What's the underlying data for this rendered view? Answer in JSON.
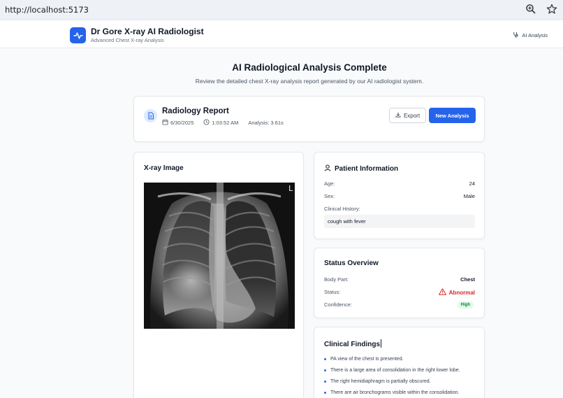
{
  "browser": {
    "url": "http://localhost:5173",
    "icons": [
      "zoom-icon",
      "bookmark-star-icon"
    ]
  },
  "header": {
    "title": "Dr Gore X-ray AI Radiologist",
    "subtitle": "Advanced Chest X-ray Analysis",
    "nav_link": "AI Analysis",
    "logo_icon": "activity-pulse-icon",
    "brand_color": "#2563eb"
  },
  "hero": {
    "title": "AI Radiological Analysis Complete",
    "subtitle": "Review the detailed chest X-ray analysis report generated by our AI radiologist system."
  },
  "report": {
    "title": "Radiology Report",
    "date": "6/30/2025",
    "time": "1:03:52 AM",
    "analysis_time": "Analysis: 3.61s",
    "export_label": "Export",
    "new_analysis_label": "New Analysis"
  },
  "xray": {
    "heading": "X-ray Image",
    "marker": "L"
  },
  "patient": {
    "heading": "Patient Information",
    "age_label": "Age:",
    "age_value": "24",
    "sex_label": "Sex:",
    "sex_value": "Male",
    "history_label": "Clinical History:",
    "history_value": "cough with fever"
  },
  "status": {
    "heading": "Status Overview",
    "body_part_label": "Body Part:",
    "body_part_value": "Chest",
    "status_label": "Status:",
    "status_value": "Abnormal",
    "confidence_label": "Confidence:",
    "confidence_value": "High",
    "abnormal_color": "#dc2626",
    "high_color": "#15803d"
  },
  "findings": {
    "heading": "Clinical Findings",
    "items": [
      "PA view of the chest is presented.",
      "There is a large area of consolidation in the right lower lobe.",
      "The right hemidiaphragm is partially obscured.",
      "There are air bronchograms visible within the consolidation."
    ]
  }
}
